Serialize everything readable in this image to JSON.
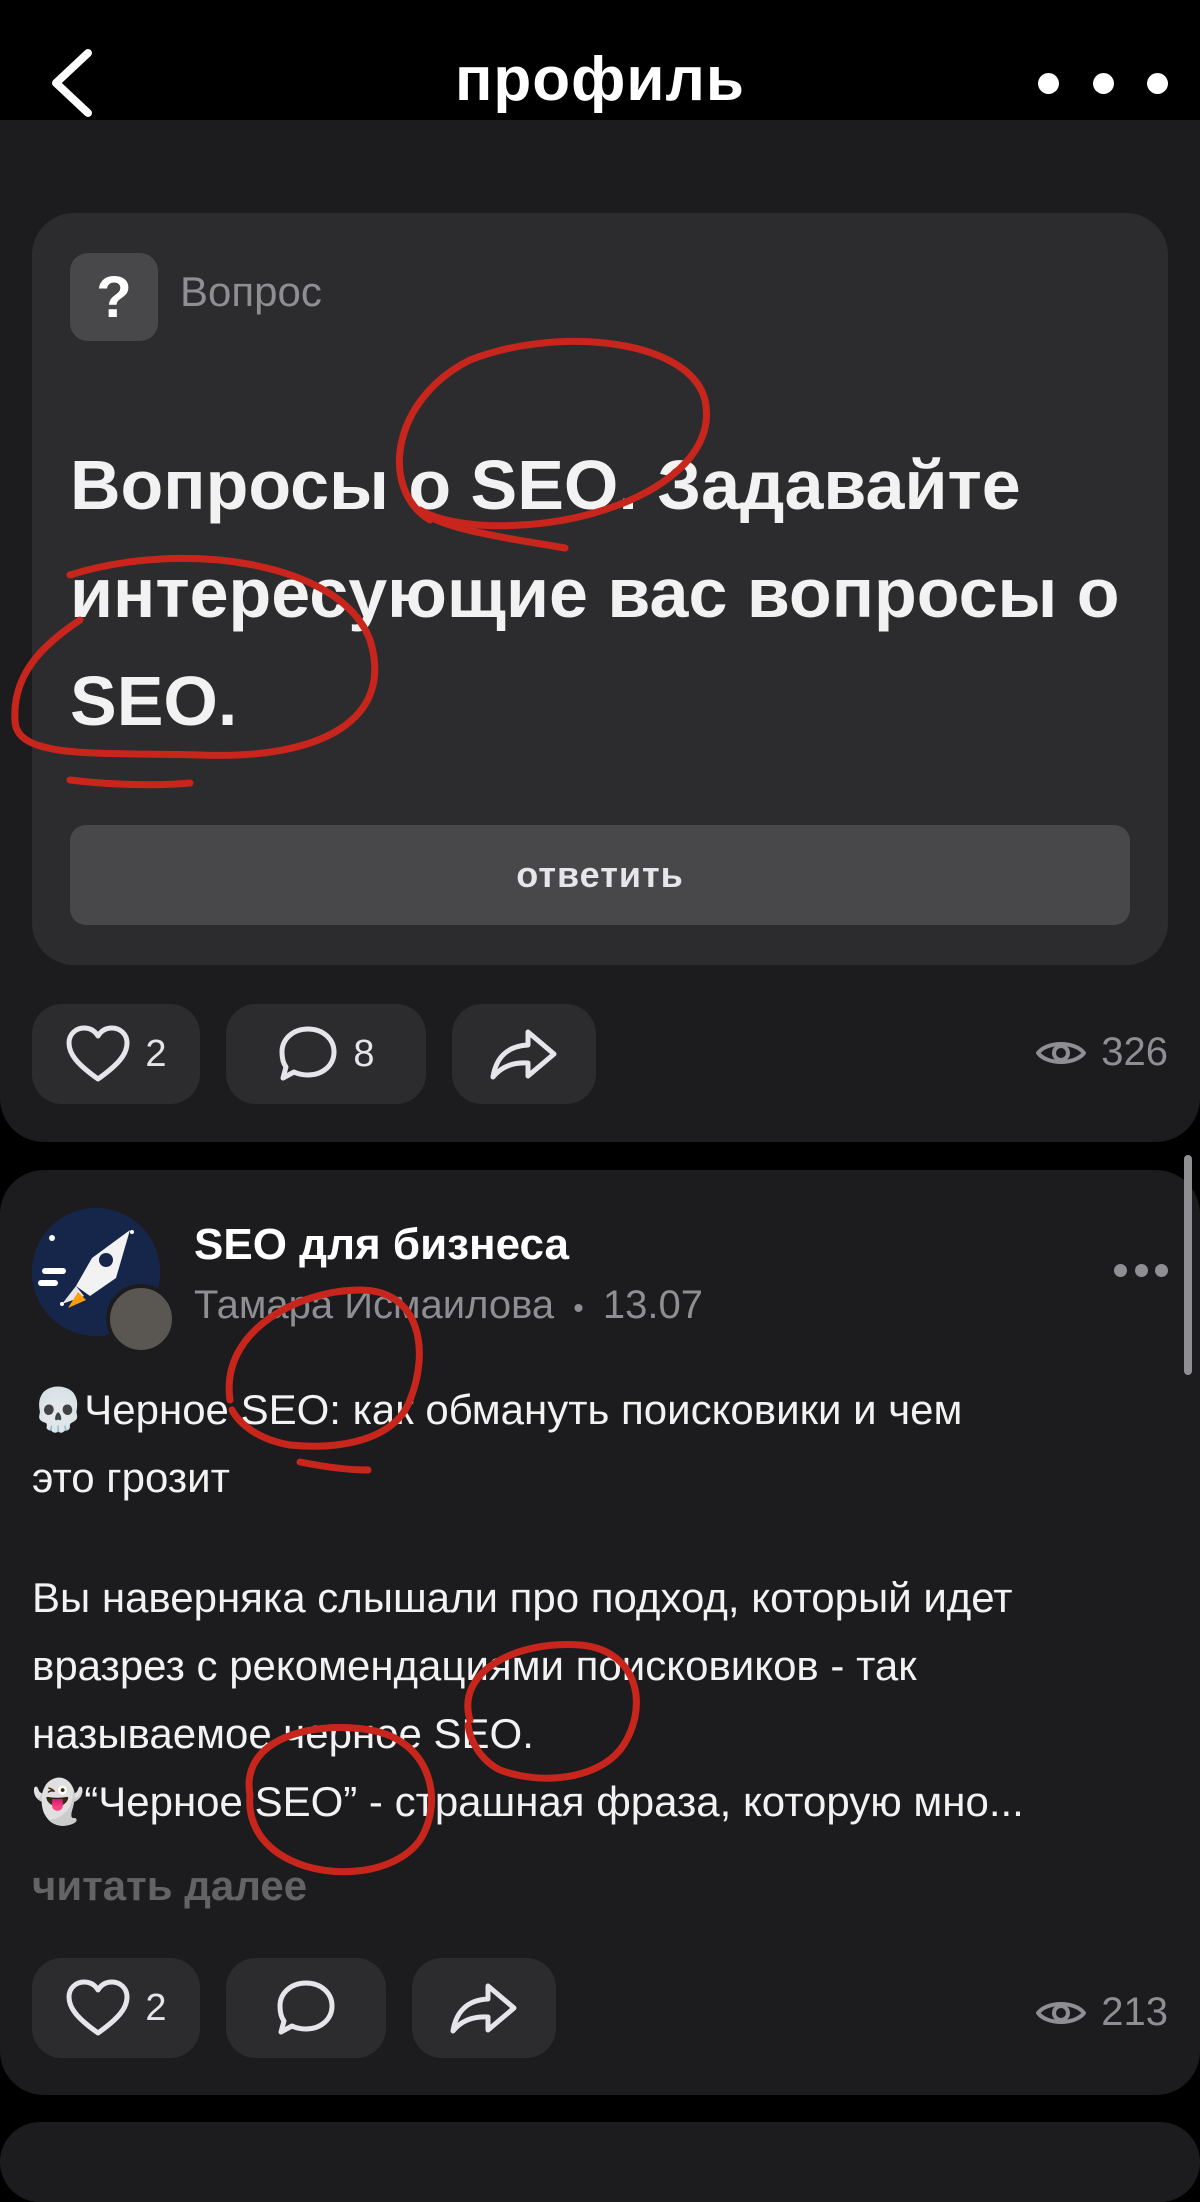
{
  "header": {
    "title": "профиль",
    "back_icon": "chevron-left-icon",
    "more_icon": "more-horizontal-icon"
  },
  "question_post": {
    "type_label": "Вопрос",
    "type_icon": "question-mark-icon",
    "question_lines": [
      "Вопросы о SEO. Задавайте",
      "интересующие вас вопросы о",
      "SEO."
    ],
    "answer_button": "ответить",
    "likes": "2",
    "comments": "8",
    "views": "326"
  },
  "post": {
    "channel_name": "SEO для бизнеса",
    "author": "Тамара Исмаилова",
    "separator": "•",
    "date": "13.07",
    "body_lines": [
      "💀Черное SEO: как обмануть поисковики и чем",
      "это грозит",
      "",
      "Вы наверняка слышали про подход, который идет",
      "вразрез с рекомендациями поисковиков - так",
      "называемое черное SEO.",
      "👻“Черное SEO” - страшная фраза, которую мно..."
    ],
    "read_more": "читать далее",
    "likes": "2",
    "views": "213"
  },
  "colors": {
    "background": "#000000",
    "card": "#1c1c1e",
    "inner_card": "#2c2c2e",
    "button": "#48484a",
    "secondary_text": "#8e8e93",
    "annotation_red": "#c8261c"
  }
}
